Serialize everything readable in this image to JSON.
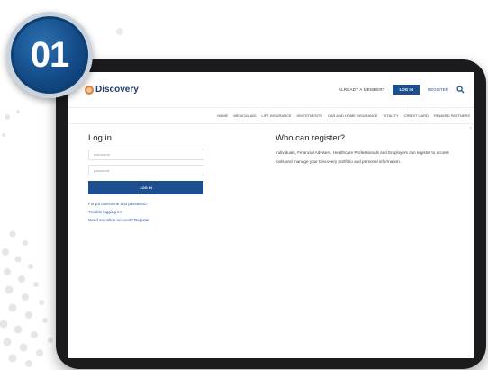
{
  "badge": {
    "number": "01"
  },
  "brand": {
    "name": "Discovery"
  },
  "header": {
    "already_member": "ALREADY A MEMBER?",
    "login_button": "LOG IN",
    "register_link": "REGISTER",
    "search_icon": "search-icon"
  },
  "nav": {
    "items": [
      "HOME",
      "MEDICAL AID",
      "LIFE INSURANCE",
      "INVESTMENTS",
      "CAR AND HOME INSURANCE",
      "VITALITY",
      "CREDIT CARD",
      "REWARD PARTNERS"
    ]
  },
  "login": {
    "title": "Log in",
    "username_placeholder": "username",
    "password_placeholder": "password",
    "submit_label": "LOG IN",
    "forgot_link": "Forgot username and password?",
    "trouble_link": "Trouble logging in?",
    "register_link": "Need an online account? Register"
  },
  "register": {
    "title": "Who can register?",
    "text": "Individuals, Financial Advisers, Healthcare Professionals and Employers can register to access tools and manage your Discovery portfolio and personal information."
  },
  "colors": {
    "brand_blue": "#1d4f8f",
    "badge_blue": "#124a86",
    "logo_orange": "#d9823b"
  }
}
